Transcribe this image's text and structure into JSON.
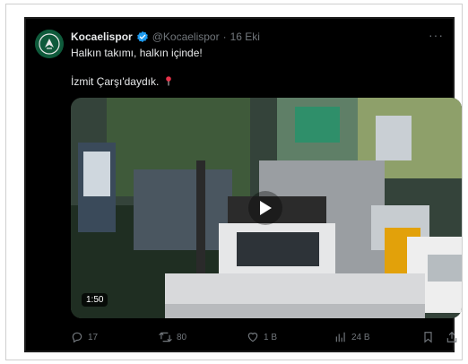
{
  "tweet": {
    "display_name": "Kocaelispor",
    "handle": "@Kocaelispor",
    "separator": "·",
    "date": "16 Eki",
    "more_label": "···",
    "lines": [
      "Halkın takımı, halkın içinde!",
      "İzmit Çarşı'daydık."
    ],
    "pin_icon": "round-pushpin-icon",
    "verified_color": "#1d9bf0"
  },
  "media": {
    "type": "video",
    "duration": "1:50",
    "play_icon": "play-icon"
  },
  "actions": {
    "replies": "17",
    "retweets": "80",
    "likes": "1 B",
    "views": "24 B"
  },
  "colors": {
    "background": "#000000",
    "text": "#e7e9ea",
    "muted": "#71767b",
    "accent": "#1d9bf0"
  }
}
